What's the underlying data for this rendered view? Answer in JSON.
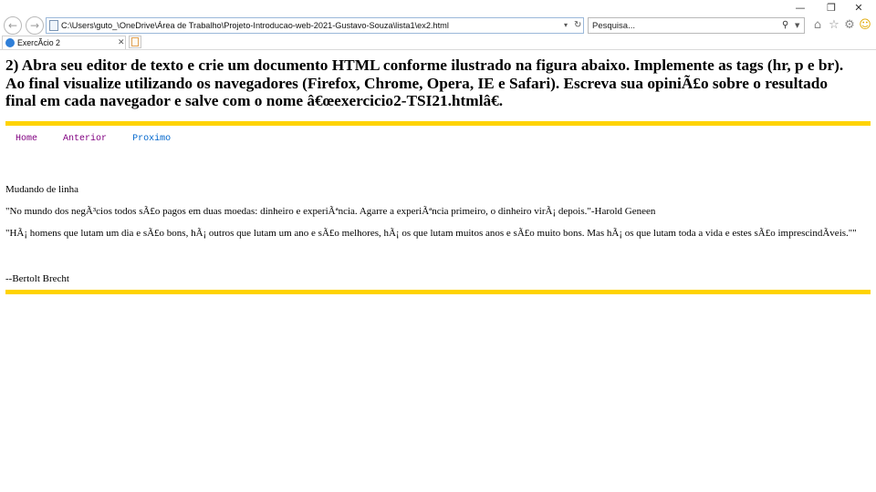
{
  "window": {
    "minimize": "—",
    "restore": "❐",
    "close": "✕"
  },
  "nav_buttons": {
    "back_icon": "back-arrow-icon",
    "forward_icon": "forward-arrow-icon"
  },
  "address_bar": {
    "url": "C:\\Users\\guto_\\OneDrive\\Área de Trabalho\\Projeto-Introducao-web-2021-Gustavo-Souza\\lista1\\ex2.html"
  },
  "search": {
    "placeholder": "Pesquisa..."
  },
  "tab": {
    "title": "ExercÃ­cio 2"
  },
  "page": {
    "heading": "2) Abra seu editor de texto e crie um documento HTML conforme ilustrado na figura abaixo. Implemente as tags (hr, p e br). Ao final visualize utilizando os navegadores (Firefox, Chrome, Opera, IE e Safari). Escreva sua opiniÃ£o sobre o resultado final em cada navegador e salve com o nome â€œexercicio2-TSI21.htmlâ€.",
    "nav_links": [
      "Home",
      "Anterior",
      "Proximo"
    ],
    "line_break_title": "Mudando de linha",
    "quote1": "\"No mundo dos negÃ³cios todos sÃ£o pagos em duas moedas: dinheiro e experiÃªncia. Agarre a experiÃªncia primeiro, o dinheiro virÃ¡ depois.\"-Harold Geneen",
    "quote2": "\"HÃ¡ homens que lutam um dia e sÃ£o bons, hÃ¡ outros que lutam um ano e sÃ£o melhores, hÃ¡ os que lutam muitos anos e sÃ£o muito bons. Mas hÃ¡ os que lutam toda a vida e estes sÃ£o imprescindÃ­veis.\"\"",
    "author": "--Bertolt Brecht"
  },
  "colors": {
    "hr": "#ffd300",
    "visited_link": "#800080",
    "link": "#0066cc"
  }
}
